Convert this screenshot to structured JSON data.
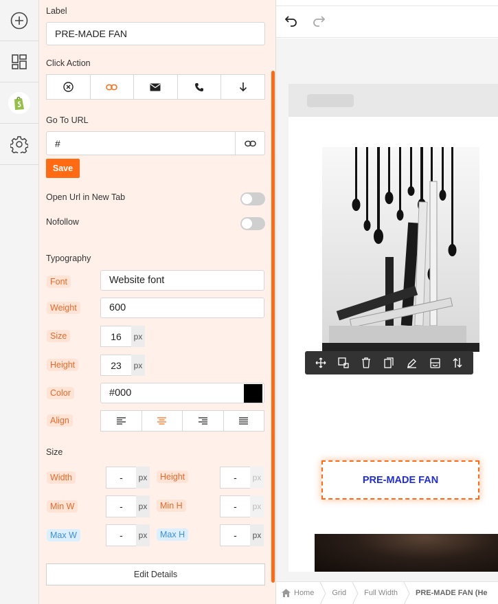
{
  "settings": {
    "label_heading": "Label",
    "label_value": "PRE-MADE FAN",
    "click_action_heading": "Click Action",
    "click_actions": [
      "none",
      "link",
      "email",
      "phone",
      "download"
    ],
    "go_to_url_heading": "Go To URL",
    "url_value": "#",
    "save_label": "Save",
    "open_new_tab_label": "Open Url in New Tab",
    "nofollow_label": "Nofollow",
    "typography_heading": "Typography",
    "font_label": "Font",
    "font_value": "Website font",
    "weight_label": "Weight",
    "weight_value": "600",
    "size_label": "Size",
    "size_value": "16",
    "height_label": "Height",
    "height_value": "23",
    "unit_px": "px",
    "color_label": "Color",
    "color_value": "#000",
    "color_swatch": "#000000",
    "align_label": "Align",
    "size_heading": "Size",
    "width_label": "Width",
    "dim_height_label": "Height",
    "min_w_label": "Min W",
    "min_h_label": "Min H",
    "max_w_label": "Max W",
    "max_h_label": "Max H",
    "dash": "-",
    "edit_details_label": "Edit Details"
  },
  "canvas": {
    "button_text": "PRE-MADE FAN",
    "toolbar_icons": [
      "move-icon",
      "resize-icon",
      "trash-icon",
      "duplicate-icon",
      "edit-pen-icon",
      "layer-icon",
      "reorder-icon"
    ]
  },
  "breadcrumb": {
    "home": "Home",
    "grid": "Grid",
    "full_width": "Full Width",
    "current": "PRE-MADE FAN (He"
  },
  "colors": {
    "accent": "#ff6a13",
    "button_text": "#1f2ddd",
    "panel_bg": "#fff1ea"
  }
}
